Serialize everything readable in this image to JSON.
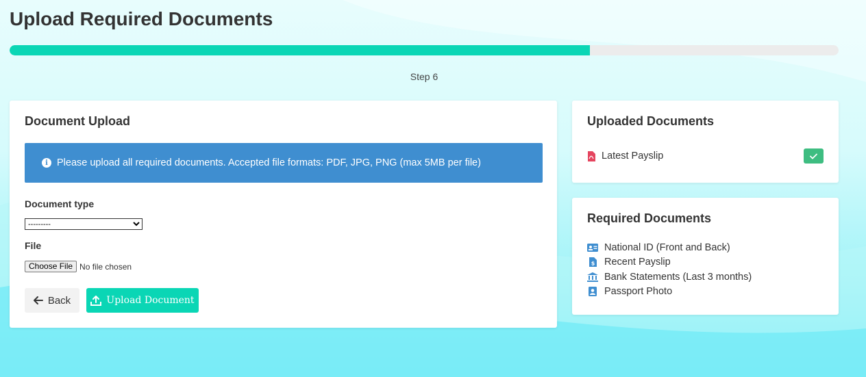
{
  "page": {
    "title": "Upload Required Documents",
    "progress_fraction": 0.7,
    "step_label": "Step 6"
  },
  "upload_card": {
    "title": "Document Upload",
    "info_text": "Please upload all required documents. Accepted file formats: PDF, JPG, PNG (max 5MB per file)",
    "document_type_label": "Document type",
    "document_type_selected": "---------",
    "file_label": "File",
    "choose_file_label": "Choose File",
    "no_file_text": "No file chosen",
    "back_label": "Back",
    "upload_label": "Upload Document"
  },
  "uploaded_card": {
    "title": "Uploaded Documents",
    "items": [
      {
        "name": "Latest Payslip",
        "icon": "pdf-file-icon",
        "status_icon": "check-icon"
      }
    ]
  },
  "required_card": {
    "title": "Required Documents",
    "items": [
      {
        "label": "National ID (Front and Back)",
        "icon": "id-card-icon"
      },
      {
        "label": "Recent Payslip",
        "icon": "invoice-icon"
      },
      {
        "label": "Bank Statements (Last 3 months)",
        "icon": "bank-icon"
      },
      {
        "label": "Passport Photo",
        "icon": "portrait-icon"
      }
    ]
  },
  "colors": {
    "accent": "#0ad6b5",
    "info": "#3f8ed0",
    "success": "#3ebd81",
    "pdf": "#e5455f",
    "icon_blue": "#3f8ed0"
  }
}
